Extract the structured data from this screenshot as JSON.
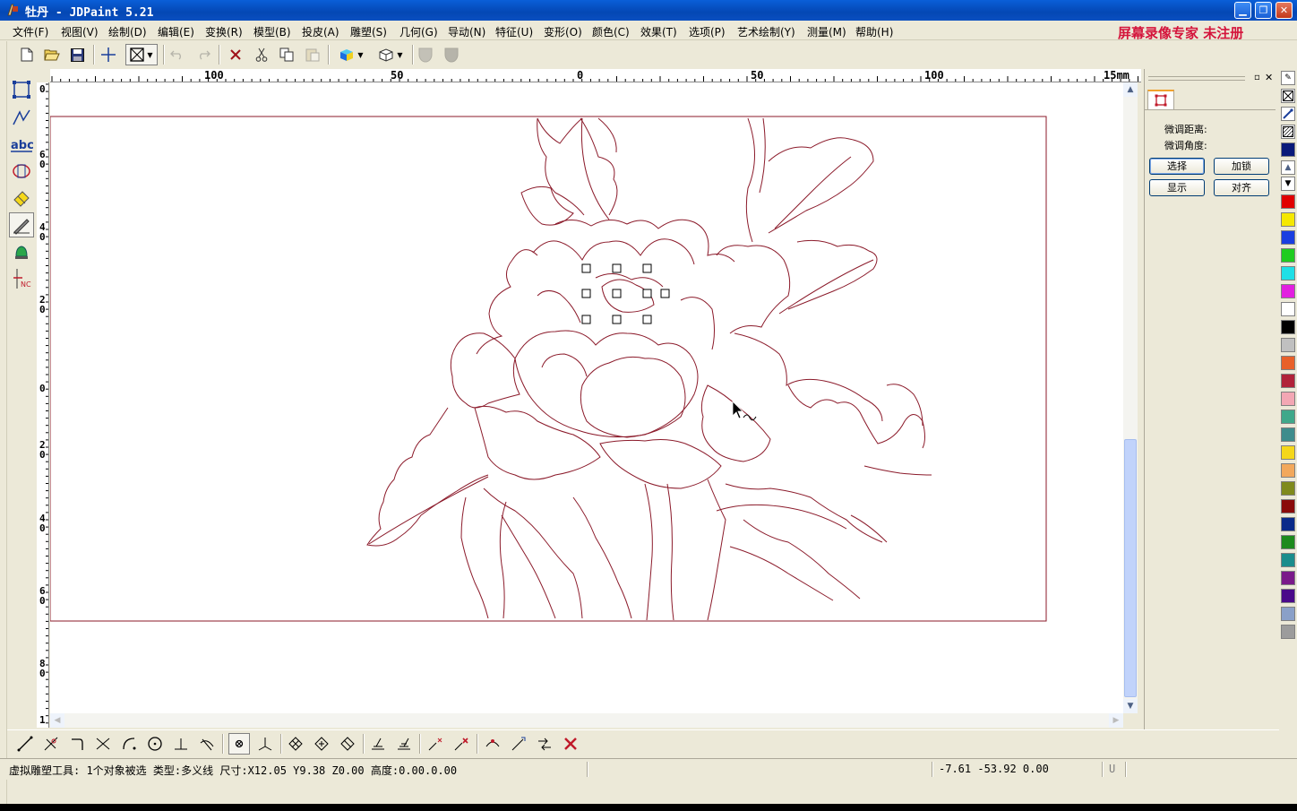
{
  "window": {
    "title": "牡丹 - JDPaint 5.21",
    "controls": [
      "_",
      "□",
      "×"
    ]
  },
  "watermark": "屏幕录像专家  未注册",
  "menu": [
    "文件(F)",
    "视图(V)",
    "绘制(D)",
    "编辑(E)",
    "变换(R)",
    "模型(B)",
    "投皮(A)",
    "雕塑(S)",
    "几何(G)",
    "导动(N)",
    "特征(U)",
    "变形(O)",
    "颜色(C)",
    "效果(T)",
    "选项(P)",
    "艺术绘制(Y)",
    "测量(M)",
    "帮助(H)"
  ],
  "toolbar_icons": [
    "new-file-icon",
    "open-file-icon",
    "save-icon",
    "crosshair-icon",
    "select-box-icon",
    "undo-icon",
    "redo-icon",
    "delete-icon",
    "cut-icon",
    "copy-icon",
    "paste-icon",
    "color-cube-icon",
    "view-3d-icon",
    "shield-icon",
    "shield-filled-icon"
  ],
  "rulers": {
    "horizontal": [
      "100",
      "50",
      "0",
      "50",
      "100",
      "15mm"
    ],
    "vertical": [
      "0",
      "6 0",
      "4 0",
      "2 0",
      "0",
      "2 0",
      "4 0",
      "6 0",
      "8 0",
      "1"
    ]
  },
  "right_panel": {
    "fine_distance_label": "微调距离:",
    "fine_angle_label": "微调角度:",
    "buttons": {
      "select": "选择",
      "lock": "加锁",
      "show": "显示",
      "align": "对齐"
    }
  },
  "palette": {
    "swatches": [
      "#e00000",
      "#f5e800",
      "#1a3ee0",
      "#1fcc1f",
      "#1fdfe6",
      "#e21fe0",
      "#ffffff",
      "#000000",
      "#c0c0c0",
      "#e8602a",
      "#b0223a",
      "#f3a7b4",
      "#3fa88a",
      "#3e8c8c",
      "#f5d71a",
      "#f2a85c",
      "#7f8a1c",
      "#8a0a0a",
      "#0a2a8a",
      "#1d8a1d",
      "#1a8c8c",
      "#7a1a8a",
      "#4a0a8a",
      "#8aa0c8",
      "#9c9c9c"
    ]
  },
  "drawing": {
    "line_color": "#8b1a2a",
    "frame_color": "#8b1a2a"
  },
  "status": {
    "message": "虚拟雕塑工具: 1个对象被选 类型:多义线 尺寸:X12.05 Y9.38 Z0.00 高度:0.00.0.00",
    "coords": "-7.61  -53.92  0.00",
    "mode": "U"
  }
}
